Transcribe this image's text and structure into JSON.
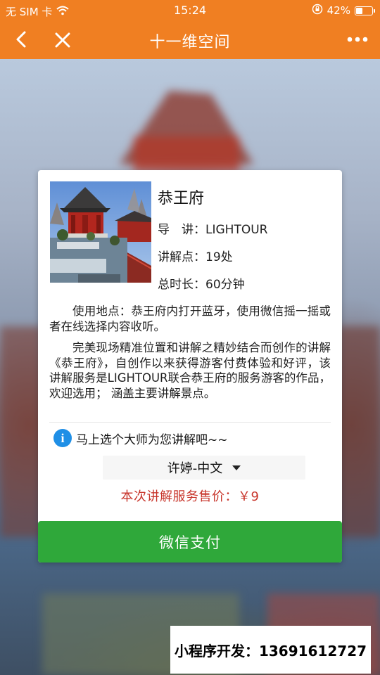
{
  "status_bar": {
    "carrier": "无 SIM 卡",
    "time": "15:24",
    "battery_percent": "42%",
    "battery_level": 0.42,
    "icons": [
      "wifi-icon",
      "orientation-lock-icon",
      "battery-icon"
    ]
  },
  "nav": {
    "title": "十一维空间",
    "icons": [
      "back-icon",
      "close-icon",
      "more-icon"
    ]
  },
  "site": {
    "name": "恭王府",
    "guide": "导　讲：LIGHTOUR",
    "points": "讲解点：19处",
    "duration": "总时长：60分钟"
  },
  "description": {
    "usage": "使用地点：恭王府内打开蓝牙，使用微信摇一摇或者在线选择内容收听。",
    "intro": "完美现场精准位置和讲解之精妙结合而创作的讲解《恭王府》，自创作以来获得游客付费体验和好评，该讲解服务是LIGHTOUR联合恭王府的服务游客的作品，欢迎选用； 涵盖主要讲解景点。"
  },
  "tip": {
    "icon": "info-icon",
    "text": "马上选个大师为您讲解吧~~"
  },
  "guide_select": {
    "selected": "许婷-中文"
  },
  "price": {
    "text": "本次讲解服务售价：￥9"
  },
  "pay_button": {
    "label": "微信支付"
  },
  "ad": {
    "text": "小程序开发：13691612727"
  },
  "colors": {
    "header": "#f07f22",
    "pay_button": "#2fa83a",
    "price_text": "#c8362c",
    "info_icon": "#1f8fe6"
  }
}
